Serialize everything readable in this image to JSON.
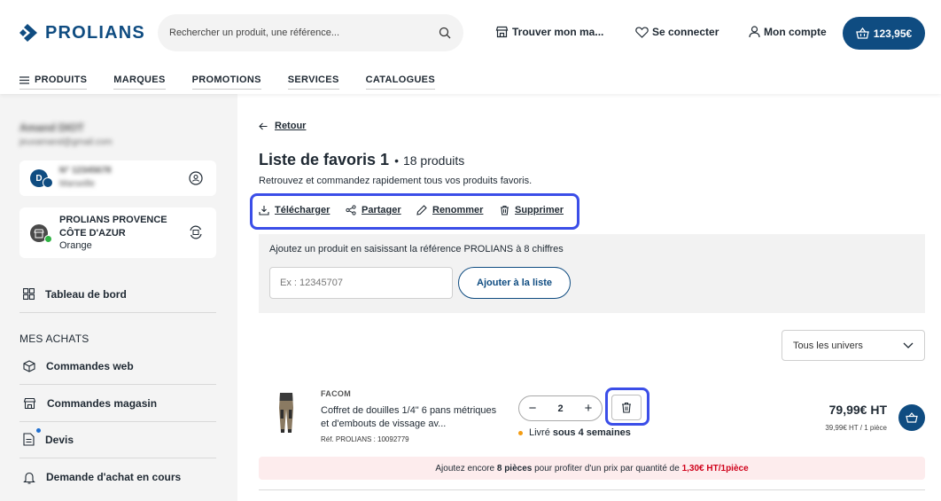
{
  "brand": {
    "name": "PROLIANS",
    "color": "#0f4c81"
  },
  "search": {
    "placeholder": "Rechercher un produit, une référence..."
  },
  "header_links": {
    "store": "Trouver mon ma...",
    "login": "Se connecter",
    "account": "Mon compte",
    "cart": "123,95€"
  },
  "nav": {
    "items": [
      "PRODUITS",
      "MARQUES",
      "PROMOTIONS",
      "SERVICES",
      "CATALOGUES"
    ]
  },
  "sidebar": {
    "user_name": "Amand DIOT",
    "user_email": "jeuxamand@gmail.com",
    "account_card": {
      "avatar": "D",
      "line1": "N° 12345678",
      "line2": "Marseille"
    },
    "store_card": {
      "name": "PROLIANS PROVENCE CÔTE D'AZUR",
      "city": "Orange"
    },
    "dashboard": "Tableau de bord",
    "section_title": "MES ACHATS",
    "items": [
      "Commandes web",
      "Commandes magasin",
      "Devis",
      "Demande d'achat en cours"
    ]
  },
  "main": {
    "back": "Retour",
    "title": "Liste de favoris 1",
    "separator": "•",
    "count": "18 produits",
    "subtitle": "Retrouvez et commandez rapidement tous vos produits favoris.",
    "actions": {
      "download": "Télécharger",
      "share": "Partager",
      "rename": "Renommer",
      "delete": "Supprimer"
    },
    "add_panel": {
      "label": "Ajoutez un produit en saisissant la référence PROLIANS à 8 chiffres",
      "placeholder": "Ex : 12345707",
      "button": "Ajouter à la liste"
    },
    "filter": {
      "selected": "Tous les univers"
    },
    "product": {
      "brand": "FACOM",
      "name": "Coffret de douilles 1/4\" 6 pans métriques et d'embouts de vissage av...",
      "ref": "Réf. PROLIANS : 10092779",
      "quantity": "2",
      "delivery_prefix": "Livré",
      "delivery_time": "sous 4 semaines",
      "price": "79,99€ HT",
      "unit_price": "39,99€ HT / 1 pièce"
    },
    "promo": {
      "part1": "Ajoutez encore",
      "qty": "8 pièces",
      "part2": "pour profiter d'un prix par quantité de",
      "price": "1,30€ HT/1pièce"
    }
  },
  "colors": {
    "accent": "#0f4c81",
    "highlight": "#3b4ee8",
    "promo_bg": "#fdeced",
    "promo_red": "#d0021b",
    "delivery_dot": "#f39c12"
  }
}
